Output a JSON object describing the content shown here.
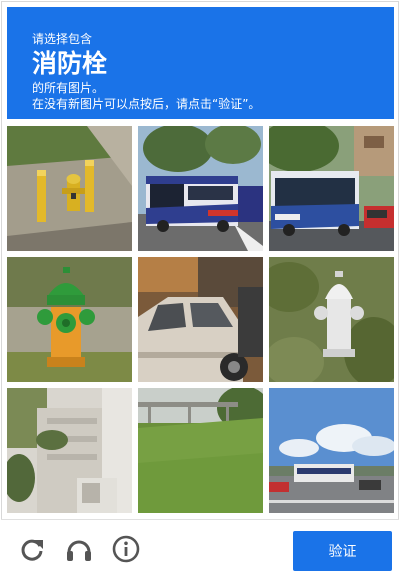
{
  "header": {
    "line1": "请选择包含",
    "object": "消防栓",
    "line2": "的所有图片。",
    "line3": "在没有新图片可以点按后，请点击“验证”。"
  },
  "tiles": [
    {
      "icon": "fire-hydrant-between-yellow-bollards"
    },
    {
      "icon": "city-bus-on-street"
    },
    {
      "icon": "city-bus-near-trees"
    },
    {
      "icon": "green-yellow-fire-hydrant"
    },
    {
      "icon": "parked-car-close-up"
    },
    {
      "icon": "white-fire-hydrant-in-grass"
    },
    {
      "icon": "stairs-with-plants"
    },
    {
      "icon": "grass-slope-with-bridge"
    },
    {
      "icon": "highway-with-bus-and-sky"
    }
  ],
  "footer": {
    "reload_icon": "reload-icon",
    "audio_icon": "headphones-icon",
    "info_icon": "info-icon",
    "verify_label": "验证"
  },
  "colors": {
    "accent": "#1a73e8",
    "icon_gray": "#555555"
  }
}
